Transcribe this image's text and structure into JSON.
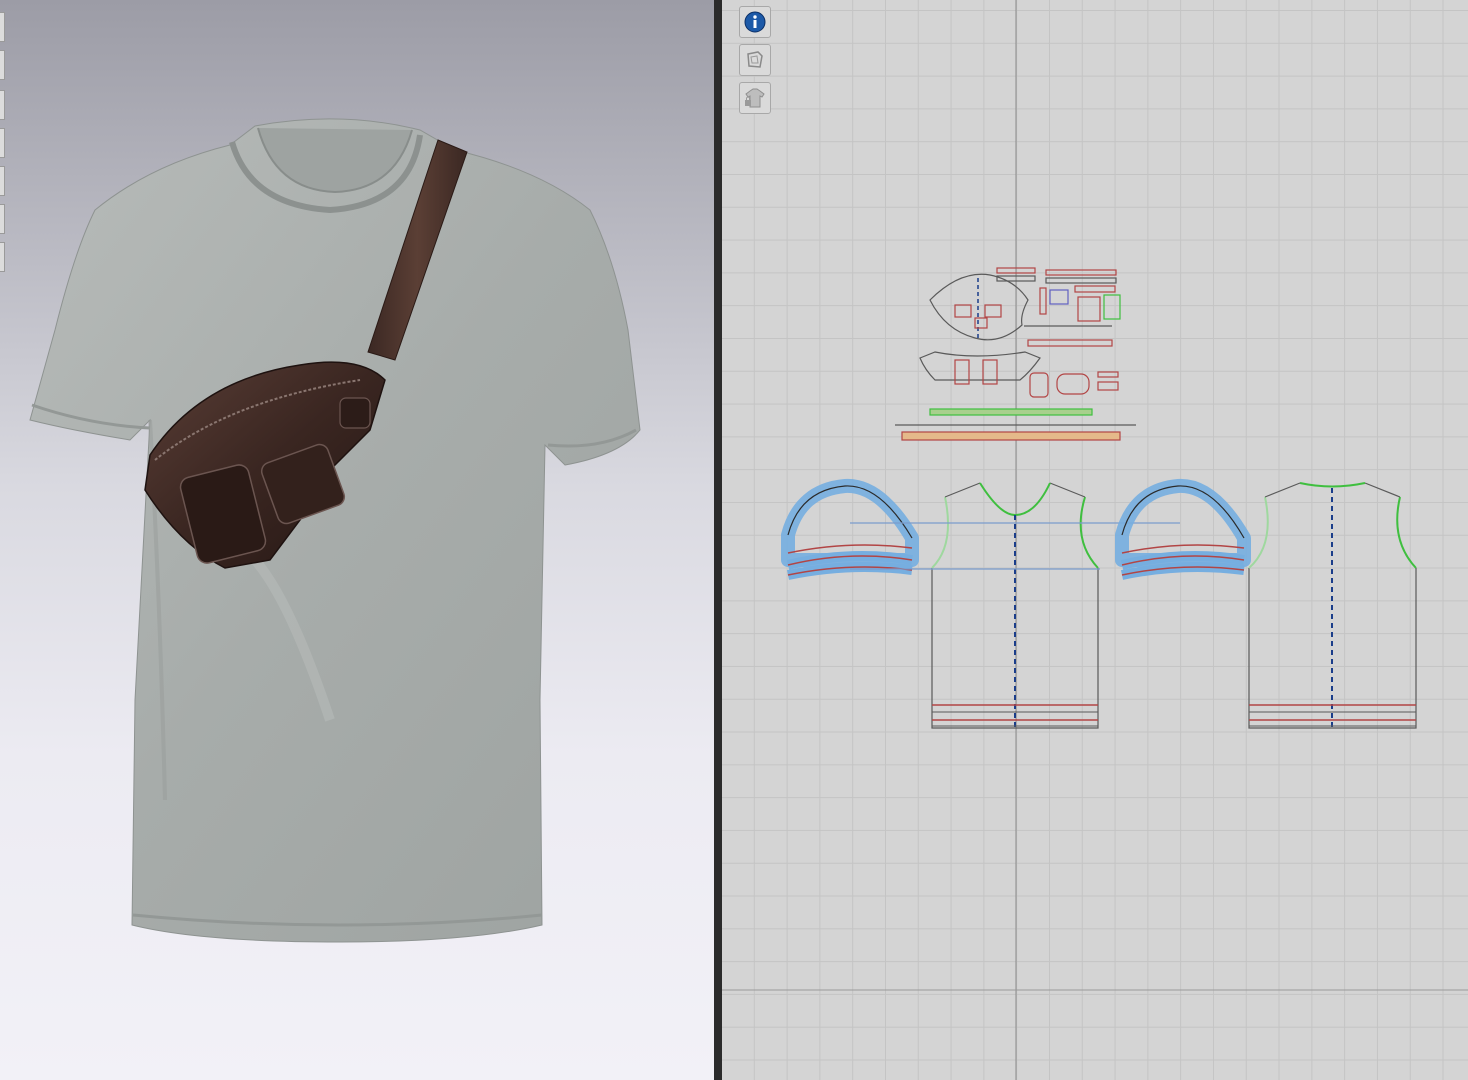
{
  "app": {
    "panels": [
      "3d-avatar-window",
      "2d-pattern-window"
    ]
  },
  "toolbar_2d": {
    "buttons": [
      {
        "name": "info-button",
        "icon": "info-icon"
      },
      {
        "name": "show-2d-pattern-button",
        "icon": "pattern-pieces-icon"
      },
      {
        "name": "lock-garment-button",
        "icon": "lock-shirt-icon"
      }
    ]
  },
  "colors": {
    "garment_fabric": "#a9aeac",
    "bag_leather": "#3a2622",
    "selection_blue": "#76aee0",
    "seam_red": "#b24545",
    "seam_green": "#3fbf3f",
    "centerline_blue": "#1a3d8a",
    "grid_bg": "#d4d4d4"
  },
  "scene": {
    "garment": "t-shirt",
    "accessory": "crossbody-belt-bag"
  }
}
